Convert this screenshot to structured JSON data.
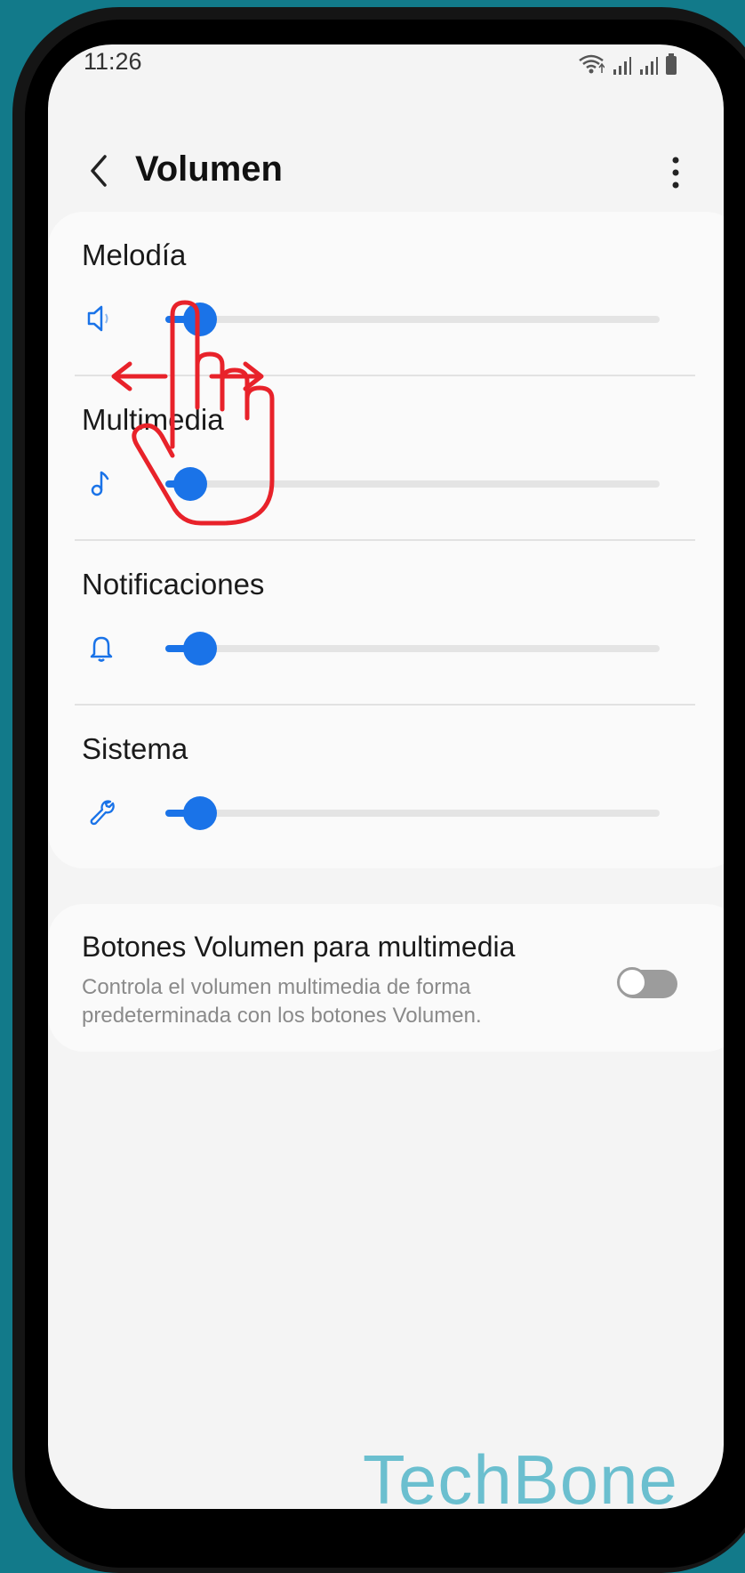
{
  "status_bar": {
    "time": "11:26"
  },
  "header": {
    "title": "Volumen"
  },
  "volume_sliders": [
    {
      "label": "Melodía",
      "icon": "speaker-icon",
      "level_fraction": 0.07
    },
    {
      "label": "Multimedia",
      "icon": "music-note-icon",
      "level_fraction": 0.05
    },
    {
      "label": "Notificaciones",
      "icon": "bell-icon",
      "level_fraction": 0.07
    },
    {
      "label": "Sistema",
      "icon": "wrench-icon",
      "level_fraction": 0.07
    }
  ],
  "media_buttons": {
    "title": "Botones Volumen para multimedia",
    "description": "Controla el volumen multimedia de forma predeterminada con los botones Volumen.",
    "enabled": false
  },
  "watermark": "TechBone",
  "colors": {
    "accent": "#1a73e8",
    "gesture": "#e8222a",
    "background": "#127a8a"
  }
}
